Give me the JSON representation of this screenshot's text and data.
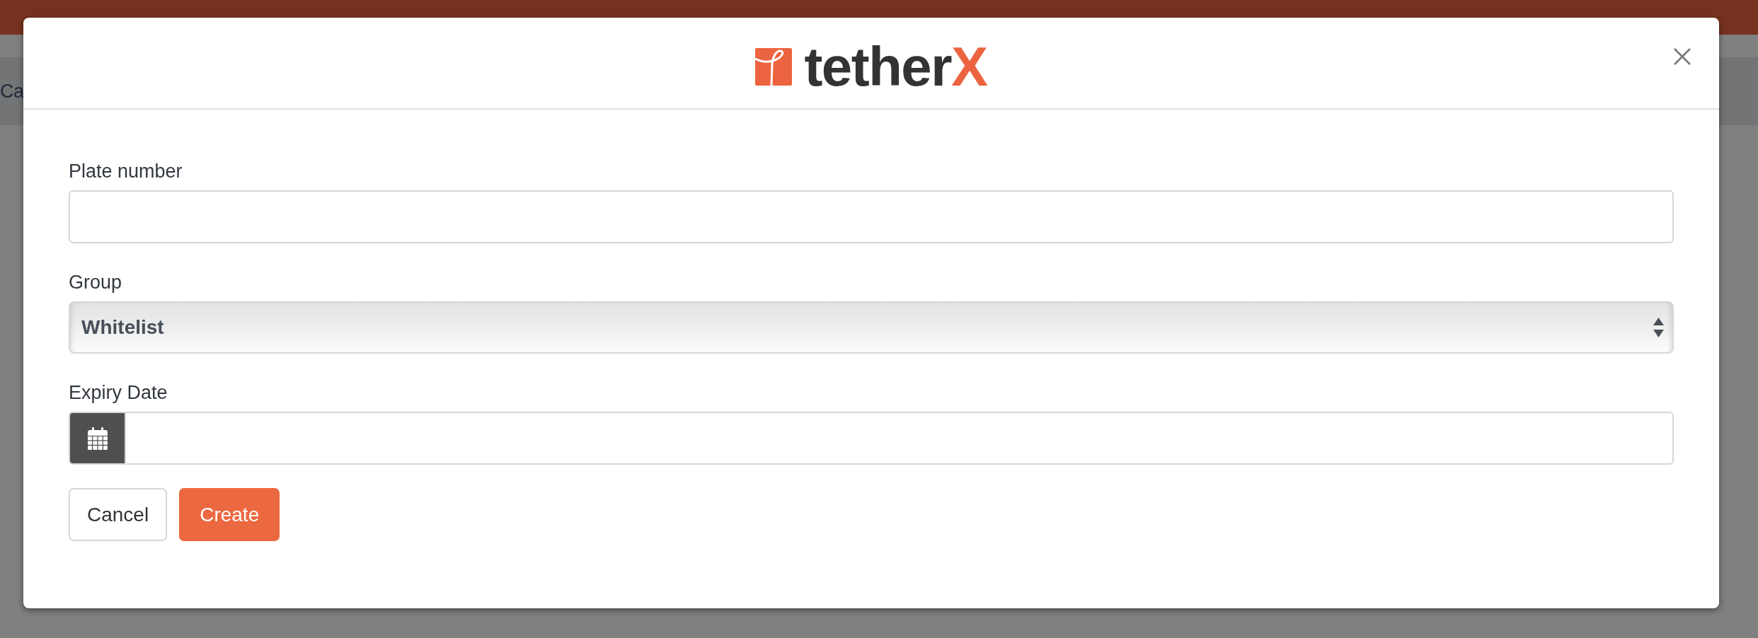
{
  "background_page": {
    "tab_text": "Ca"
  },
  "modal": {
    "logo": {
      "text": "tether",
      "accent": "X"
    },
    "fields": [
      {
        "kind": "text",
        "label": "Plate number"
      },
      {
        "kind": "select",
        "label": "Group",
        "value": "Whitelist"
      },
      {
        "kind": "date",
        "label": "Expiry Date"
      }
    ],
    "buttons": [
      {
        "kind": "secondary",
        "label": "Cancel"
      },
      {
        "kind": "primary",
        "label": "Create"
      }
    ]
  }
}
